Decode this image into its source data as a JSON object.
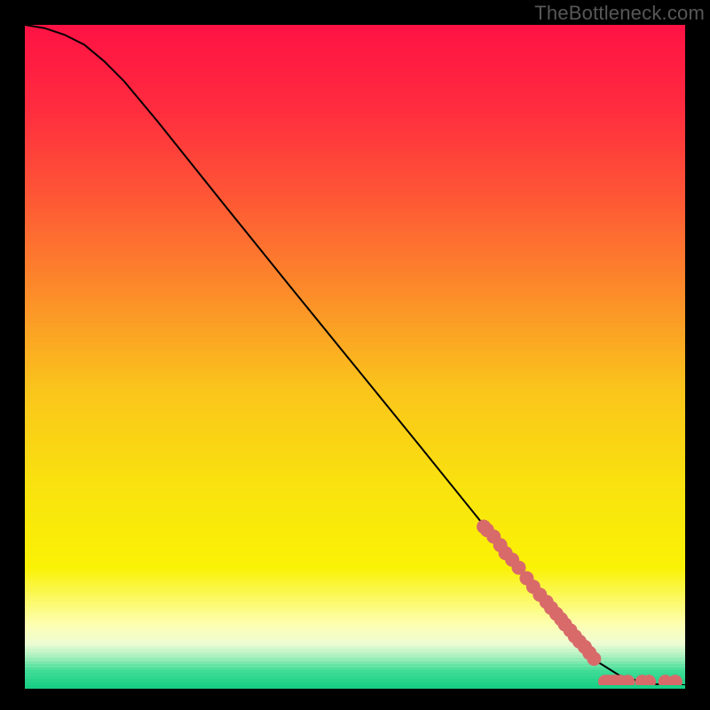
{
  "watermark": "TheBottleneck.com",
  "colors": {
    "border": "#000000",
    "curve": "#000000",
    "point_fill": "#d86a6a",
    "point_stroke": "#d86a6a"
  },
  "gradient_stops": [
    {
      "offset": 0.0,
      "color": "#ff1244"
    },
    {
      "offset": 0.12,
      "color": "#ff2b3f"
    },
    {
      "offset": 0.25,
      "color": "#fe5436"
    },
    {
      "offset": 0.4,
      "color": "#fc8b2a"
    },
    {
      "offset": 0.55,
      "color": "#fac51b"
    },
    {
      "offset": 0.7,
      "color": "#f9e30e"
    },
    {
      "offset": 0.82,
      "color": "#faf205"
    },
    {
      "offset": 0.905,
      "color": "#fdffb0"
    },
    {
      "offset": 0.935,
      "color": "#eefcd4"
    },
    {
      "offset": 0.955,
      "color": "#a8f0bf"
    },
    {
      "offset": 0.975,
      "color": "#43dd98"
    },
    {
      "offset": 1.0,
      "color": "#18cf85"
    }
  ],
  "chart_data": {
    "type": "line",
    "title": "",
    "xlabel": "",
    "ylabel": "",
    "xlim": [
      0,
      1
    ],
    "ylim": [
      0,
      1
    ],
    "x": [
      0.0,
      0.03,
      0.06,
      0.09,
      0.12,
      0.15,
      0.2,
      0.3,
      0.4,
      0.5,
      0.6,
      0.7,
      0.8,
      0.86,
      0.9,
      0.94,
      0.97,
      1.0
    ],
    "y": [
      1.0,
      0.995,
      0.985,
      0.97,
      0.945,
      0.915,
      0.855,
      0.73,
      0.606,
      0.483,
      0.36,
      0.236,
      0.113,
      0.04,
      0.015,
      0.003,
      0.0,
      0.0
    ],
    "series": [
      {
        "name": "points",
        "marker": "o",
        "x": [
          0.695,
          0.7,
          0.71,
          0.72,
          0.728,
          0.738,
          0.748,
          0.76,
          0.77,
          0.78,
          0.79,
          0.797,
          0.805,
          0.812,
          0.818,
          0.826,
          0.833,
          0.84,
          0.848,
          0.855,
          0.862,
          0.879,
          0.884,
          0.89,
          0.895,
          0.902,
          0.913,
          0.935,
          0.945,
          0.97,
          0.985
        ],
        "y": [
          0.24,
          0.235,
          0.225,
          0.212,
          0.2,
          0.19,
          0.178,
          0.162,
          0.149,
          0.137,
          0.126,
          0.117,
          0.108,
          0.1,
          0.092,
          0.083,
          0.074,
          0.066,
          0.058,
          0.049,
          0.04,
          0.005,
          0.005,
          0.005,
          0.005,
          0.005,
          0.005,
          0.005,
          0.005,
          0.005,
          0.005
        ]
      }
    ]
  }
}
